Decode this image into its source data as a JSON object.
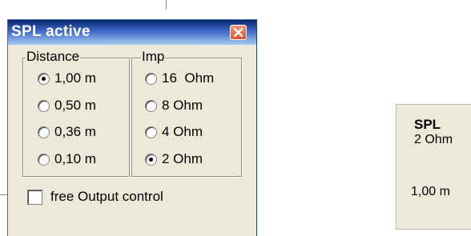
{
  "window": {
    "title": "SPL active"
  },
  "distance": {
    "legend": "Distance",
    "options": [
      "1,00 m",
      "0,50 m",
      "0,36 m",
      "0,10 m"
    ],
    "selected_index": 0
  },
  "impedance": {
    "legend": "Imp",
    "options": [
      "16  Ohm",
      "8 Ohm",
      "4 Ohm",
      "2 Ohm"
    ],
    "selected_index": 3
  },
  "free_output": {
    "label": "free Output control",
    "checked": false
  },
  "spl_panel": {
    "title": "SPL",
    "impedance": "2 Ohm",
    "distance": "1,00 m"
  },
  "colors": {
    "title_start": "#0a246a",
    "title_end": "#a6caf0",
    "face": "#ece9d8",
    "close": "#d7512d"
  }
}
